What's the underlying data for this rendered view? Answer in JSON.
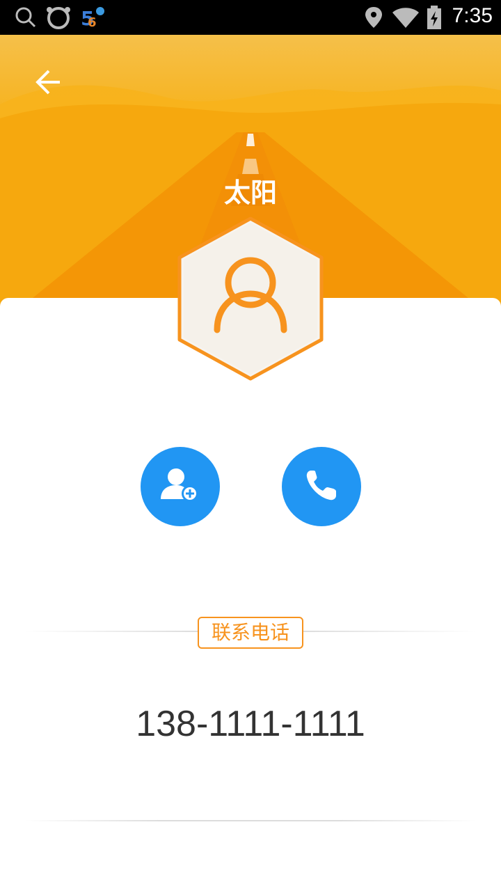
{
  "status_bar": {
    "time": "7:35",
    "left_icons": [
      "search-icon",
      "cat-face-icon",
      "app-badge-icon"
    ],
    "right_icons": [
      "location-icon",
      "wifi-icon",
      "battery-charging-icon"
    ]
  },
  "header": {
    "contact_name": "太阳",
    "back_icon": "arrow-left-icon"
  },
  "actions": {
    "add_contact_icon": "add-contact-icon",
    "call_icon": "phone-icon"
  },
  "details": {
    "section_label": "联系电话",
    "phone_number": "138-1111-1111"
  },
  "colors": {
    "header_yellow": "#f7b21c",
    "header_orange": "#f59b06",
    "accent_orange": "#f7931e",
    "action_blue": "#2196f3",
    "text_dark": "#333333"
  }
}
